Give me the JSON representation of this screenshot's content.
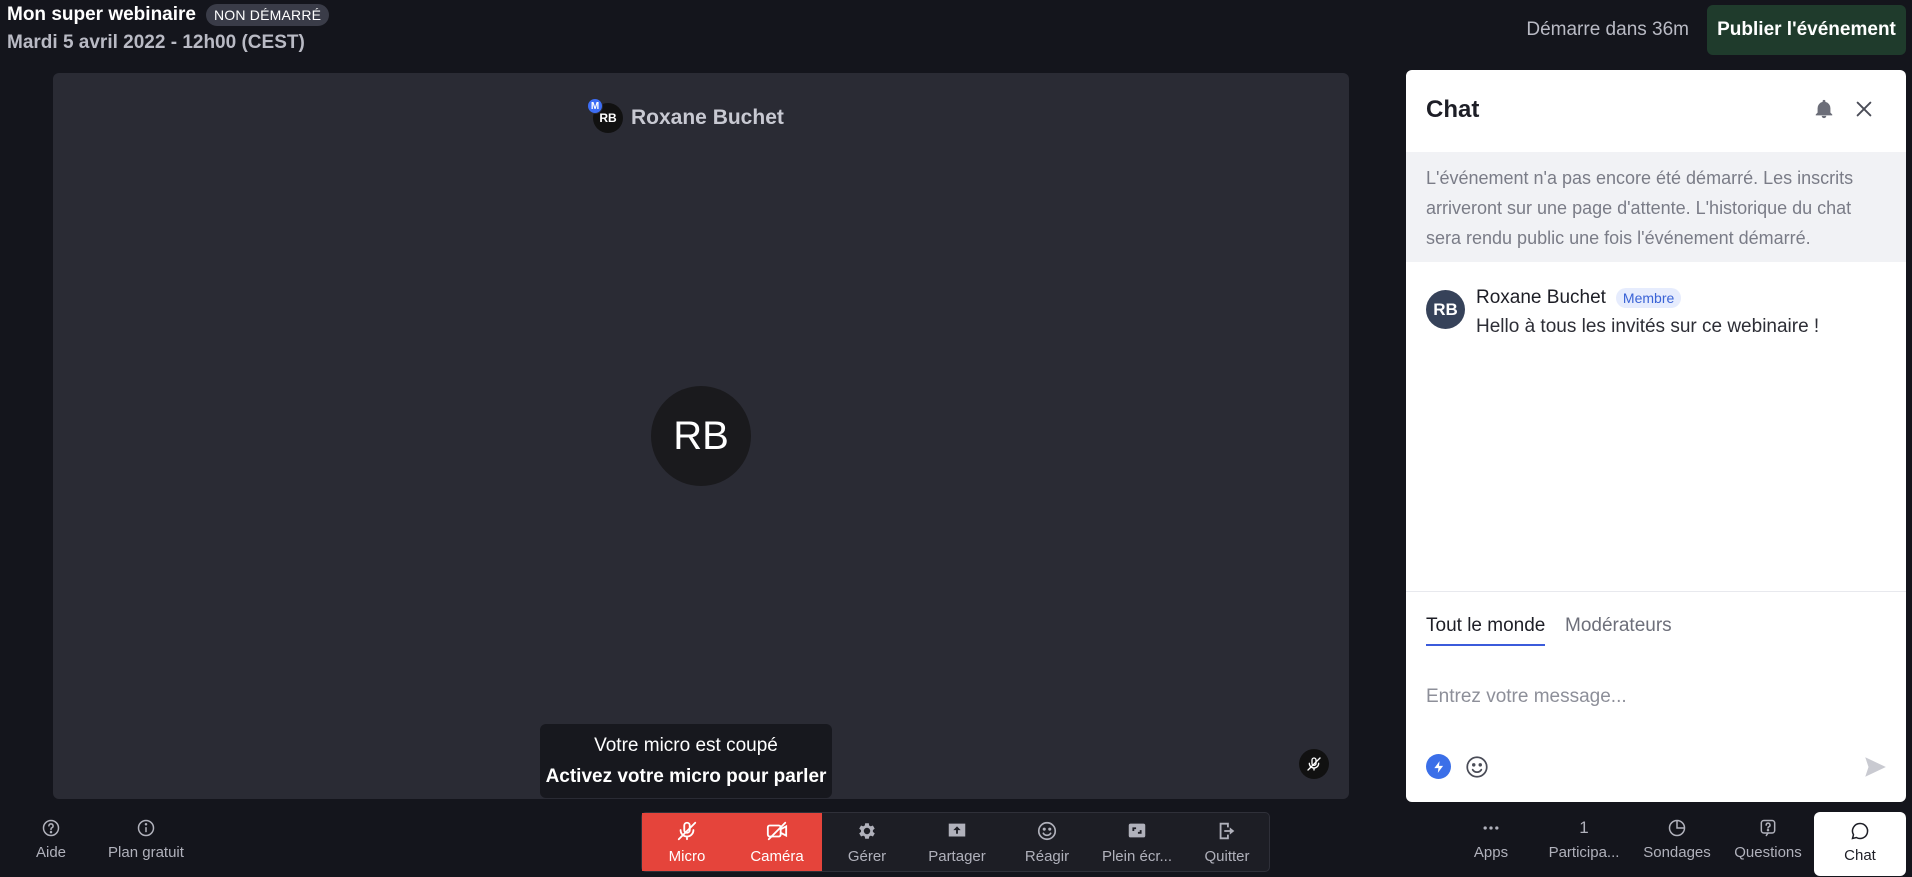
{
  "header": {
    "event_title": "Mon super webinaire",
    "status_badge": "NON DÉMARRÉ",
    "event_date": "Mardi 5 avril 2022 - 12h00 (CEST)",
    "countdown": "Démarre dans 36m",
    "publish_label": "Publier l'événement"
  },
  "stage": {
    "participant_name": "Roxane Buchet",
    "participant_initials": "RB",
    "moderator_marker": "M"
  },
  "tooltip": {
    "line1": "Votre micro est coupé",
    "line2": "Activez votre micro pour parler"
  },
  "chat": {
    "title": "Chat",
    "notice": "L'événement n'a pas encore été démarré. Les inscrits arriveront sur une page d'attente. L'historique du chat sera rendu public une fois l'événement démarré.",
    "messages": [
      {
        "initials": "RB",
        "author": "Roxane Buchet",
        "role": "Membre",
        "text": "Hello à tous les invités sur ce webinaire !"
      }
    ],
    "tabs": [
      "Tout le monde",
      "Modérateurs"
    ],
    "active_tab": "Tout le monde",
    "input_placeholder": "Entrez votre message..."
  },
  "bottombar": {
    "left": [
      {
        "label": "Aide",
        "icon": "help-circle-icon"
      },
      {
        "label": "Plan gratuit",
        "icon": "info-circle-icon"
      }
    ],
    "controls": [
      {
        "label": "Micro",
        "icon": "mic-off-icon",
        "state": "off"
      },
      {
        "label": "Caméra",
        "icon": "camera-off-icon",
        "state": "off"
      },
      {
        "label": "Gérer",
        "icon": "gear-icon"
      },
      {
        "label": "Partager",
        "icon": "share-screen-icon"
      },
      {
        "label": "Réagir",
        "icon": "smiley-icon"
      },
      {
        "label": "Plein écr...",
        "icon": "fullscreen-icon"
      },
      {
        "label": "Quitter",
        "icon": "exit-icon"
      }
    ],
    "right": [
      {
        "label": "Apps",
        "icon": "dots-icon"
      },
      {
        "label": "Participa...",
        "count": "1"
      },
      {
        "label": "Sondages",
        "icon": "poll-icon"
      },
      {
        "label": "Questions",
        "icon": "question-icon"
      },
      {
        "label": "Chat",
        "icon": "chat-bubble-icon",
        "active": true
      }
    ]
  },
  "colors": {
    "background": "#14151c",
    "stage": "#2a2b34",
    "publish": "#1f3b2c",
    "mic_off_red": "#e5443b",
    "accent_blue": "#3b5bdb"
  }
}
